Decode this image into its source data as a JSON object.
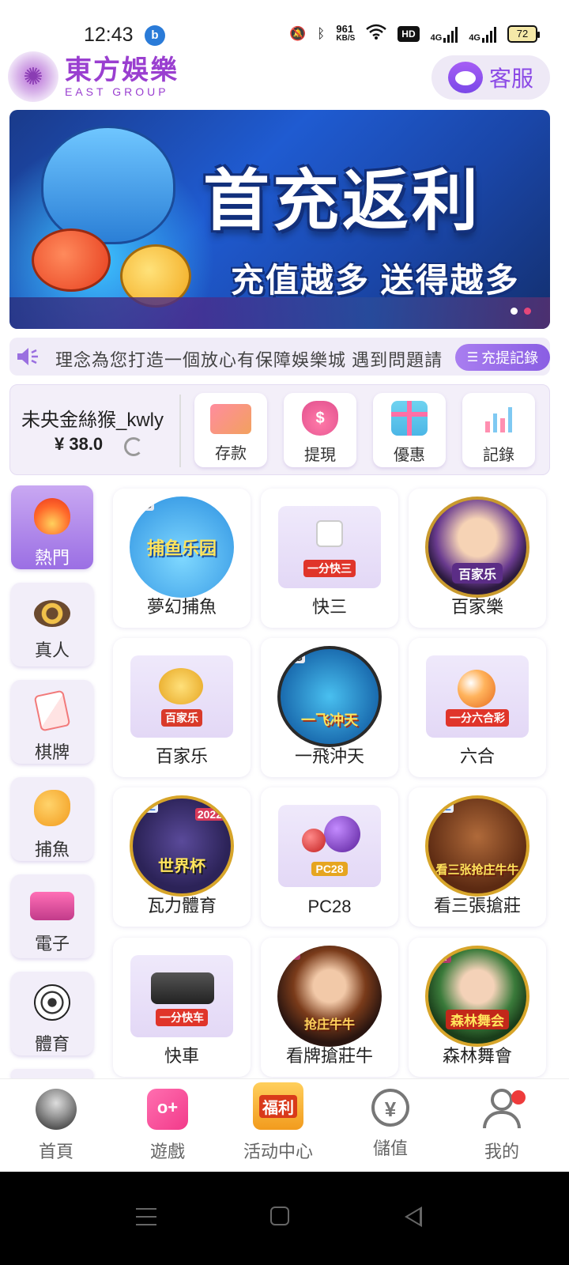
{
  "status_bar": {
    "time": "12:43",
    "app_badge": "b",
    "net_speed_value": "961",
    "net_speed_unit": "KB/S",
    "hd_label": "HD",
    "signal1_label": "4G",
    "signal2_label": "4G",
    "battery": "72"
  },
  "header": {
    "logo_cn": "東方娛樂",
    "logo_en": "EAST GROUP",
    "service_label": "客服"
  },
  "banner": {
    "title": "首充返利",
    "subtitle": "充值越多 送得越多",
    "slide_count": 2,
    "active_slide": 2
  },
  "marquee": {
    "text": "理念為您打造一個放心有保障娛樂城  遇到問題請",
    "records_label": "充提記錄"
  },
  "user": {
    "name": "未央金絲猴_kwly",
    "balance": "¥ 38.0"
  },
  "quick_actions": [
    {
      "label": "存款",
      "icon": "card-icon"
    },
    {
      "label": "提現",
      "icon": "money-bag-icon"
    },
    {
      "label": "優惠",
      "icon": "gift-icon"
    },
    {
      "label": "記錄",
      "icon": "bar-chart-icon"
    }
  ],
  "categories": [
    {
      "label": "熱門",
      "icon": "flame-icon",
      "active": true
    },
    {
      "label": "真人",
      "icon": "chip-icon"
    },
    {
      "label": "棋牌",
      "icon": "cards-icon"
    },
    {
      "label": "捕魚",
      "icon": "fish-icon"
    },
    {
      "label": "電子",
      "icon": "slot-icon"
    },
    {
      "label": "體育",
      "icon": "soccer-ball-icon"
    }
  ],
  "games": [
    {
      "label": "夢幻捕魚",
      "art_text": "捕鱼乐园",
      "tag": "AG"
    },
    {
      "label": "快三",
      "art_text": "一分快三"
    },
    {
      "label": "百家樂",
      "art_text": "百家乐"
    },
    {
      "label": "百家乐",
      "art_text": "百家乐"
    },
    {
      "label": "一飛沖天",
      "art_text": "一飞冲天",
      "tag": "AG"
    },
    {
      "label": "六合",
      "art_text": "一分六合彩"
    },
    {
      "label": "瓦力體育",
      "art_text": "世界杯",
      "tag": "WL",
      "year": "2022"
    },
    {
      "label": "PC28",
      "art_text": "PC28"
    },
    {
      "label": "看三張搶莊",
      "art_text": "看三张抢庄牛牛",
      "tag": "WL"
    },
    {
      "label": "快車",
      "art_text": "一分快车"
    },
    {
      "label": "看牌搶莊牛",
      "art_text": "抢庄牛牛",
      "tag": "KY"
    },
    {
      "label": "森林舞會",
      "art_text": "森林舞会",
      "tag": "KY"
    }
  ],
  "bottom_nav": [
    {
      "label": "首頁",
      "icon": "home-avatar-icon"
    },
    {
      "label": "遊戲",
      "icon": "gamepad-icon"
    },
    {
      "label": "活动中心",
      "icon": "welfare-box-icon",
      "art_text": "福利"
    },
    {
      "label": "儲值",
      "icon": "yuan-plus-icon"
    },
    {
      "label": "我的",
      "icon": "user-icon",
      "badge": true
    }
  ],
  "colors": {
    "accent": "#9a3fd0",
    "accent_light": "#f2eef9",
    "badge_red": "#ee3b3b"
  }
}
